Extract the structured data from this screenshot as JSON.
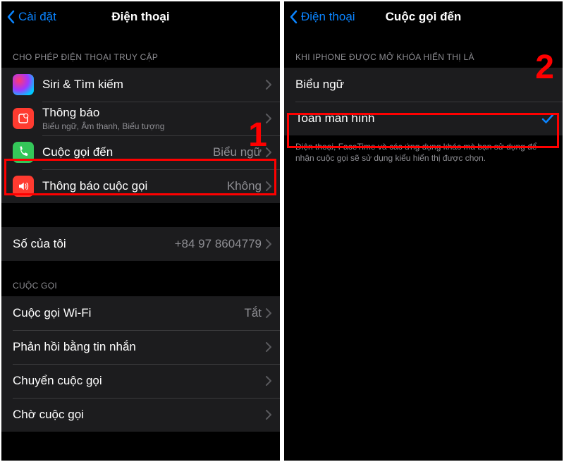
{
  "left": {
    "back": "Cài đặt",
    "title": "Điện thoại",
    "section_allow": "CHO PHÉP ĐIỆN THOẠI TRUY CẬP",
    "rows": {
      "siri": "Siri & Tìm kiếm",
      "notif": "Thông báo",
      "notif_sub": "Biểu ngữ, Âm thanh, Biểu tượng",
      "incoming": "Cuộc gọi đến",
      "incoming_val": "Biểu ngữ",
      "announce": "Thông báo cuộc gọi",
      "announce_val": "Không"
    },
    "my_number_label": "Số của tôi",
    "my_number_val": "+84 97 8604779",
    "section_calls": "CUỘC GỌI",
    "calls": {
      "wifi": "Cuộc gọi Wi-Fi",
      "wifi_val": "Tắt",
      "sms_reply": "Phản hồi bằng tin nhắn",
      "forward": "Chuyển cuộc gọi",
      "waiting": "Chờ cuộc gọi"
    },
    "step": "1"
  },
  "right": {
    "back": "Điện thoại",
    "title": "Cuộc gọi đến",
    "section": "KHI IPHONE ĐƯỢC MỞ KHÓA HIỂN THỊ LÀ",
    "banner": "Biểu ngữ",
    "fullscreen": "Toàn màn hình",
    "footer": "Điện thoại, FaceTime và các ứng dụng khác mà bạn sử dụng để nhận cuộc gọi sẽ sử dụng kiểu hiển thị được chọn.",
    "step": "2"
  }
}
